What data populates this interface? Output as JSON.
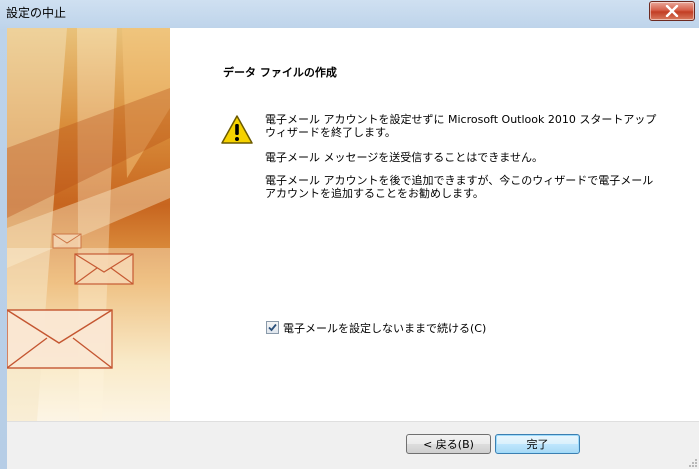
{
  "window": {
    "title": "設定の中止"
  },
  "content": {
    "heading": "データ ファイルの作成",
    "message1": "電子メール アカウントを設定せずに Microsoft Outlook 2010 スタートアップ ウィザードを終了します。",
    "message2": "電子メール メッセージを送受信することはできません。",
    "message3": "電子メール アカウントを後で追加できますが、今このウィザードで電子メール アカウントを追加することをお勧めします。"
  },
  "checkbox": {
    "label": "電子メールを設定しないままで続ける(C)",
    "checked": true
  },
  "buttons": {
    "back_label": "< 戻る(B)",
    "finish_label": "完了"
  },
  "icons": {
    "warning": "warning-icon",
    "close": "close-icon"
  },
  "colors": {
    "warning_fill": "#f6d200",
    "close_button": "#c8452c"
  }
}
